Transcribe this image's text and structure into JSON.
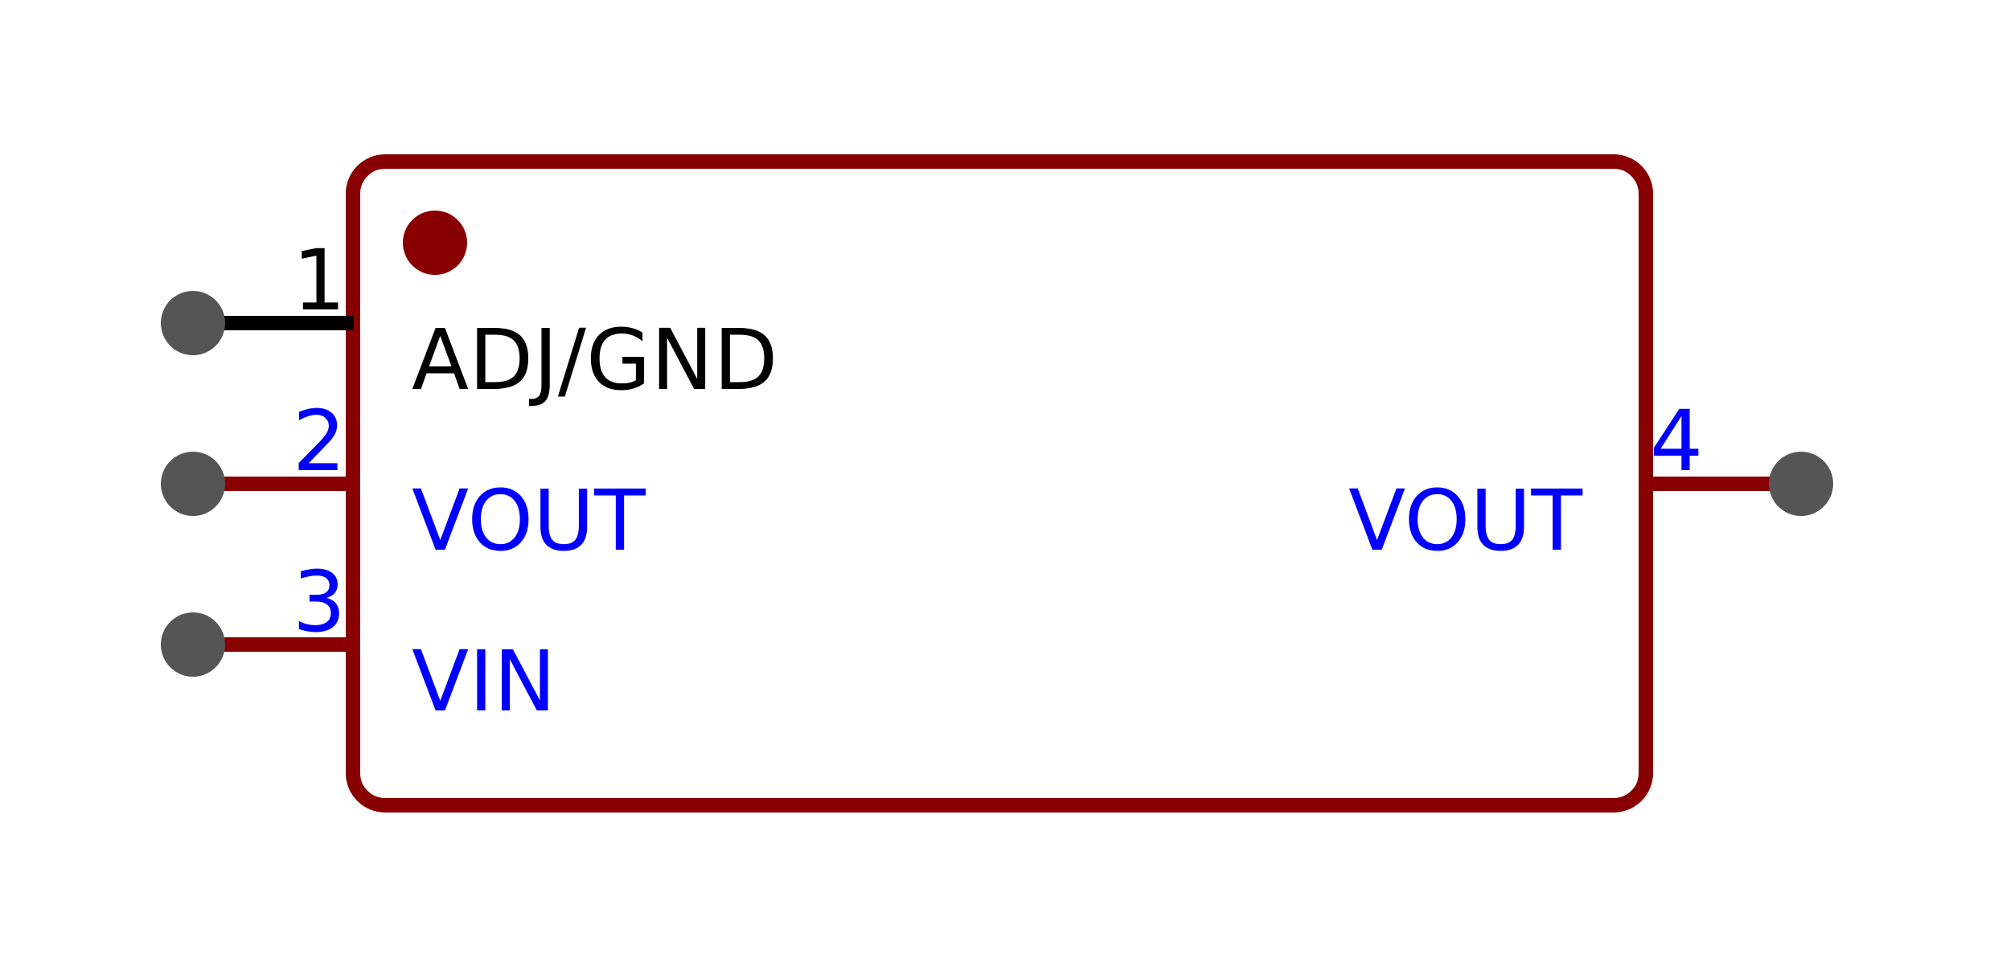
{
  "colors": {
    "body_outline": "#880000",
    "pin_line_power": "#880000",
    "pin_line_signal": "#000000",
    "pin_endpoint": "#555555",
    "text_power": "#0000ff",
    "text_signal": "#000000",
    "pin1_marker": "#880000",
    "background": "#ffffff"
  },
  "component": {
    "pin1_marker_icon": "filled-circle-icon"
  },
  "pins": [
    {
      "number": "1",
      "name": "ADJ/GND",
      "side": "left",
      "kind": "signal"
    },
    {
      "number": "2",
      "name": "VOUT",
      "side": "left",
      "kind": "power"
    },
    {
      "number": "3",
      "name": "VIN",
      "side": "left",
      "kind": "power"
    },
    {
      "number": "4",
      "name": "VOUT",
      "side": "right",
      "kind": "power"
    }
  ]
}
